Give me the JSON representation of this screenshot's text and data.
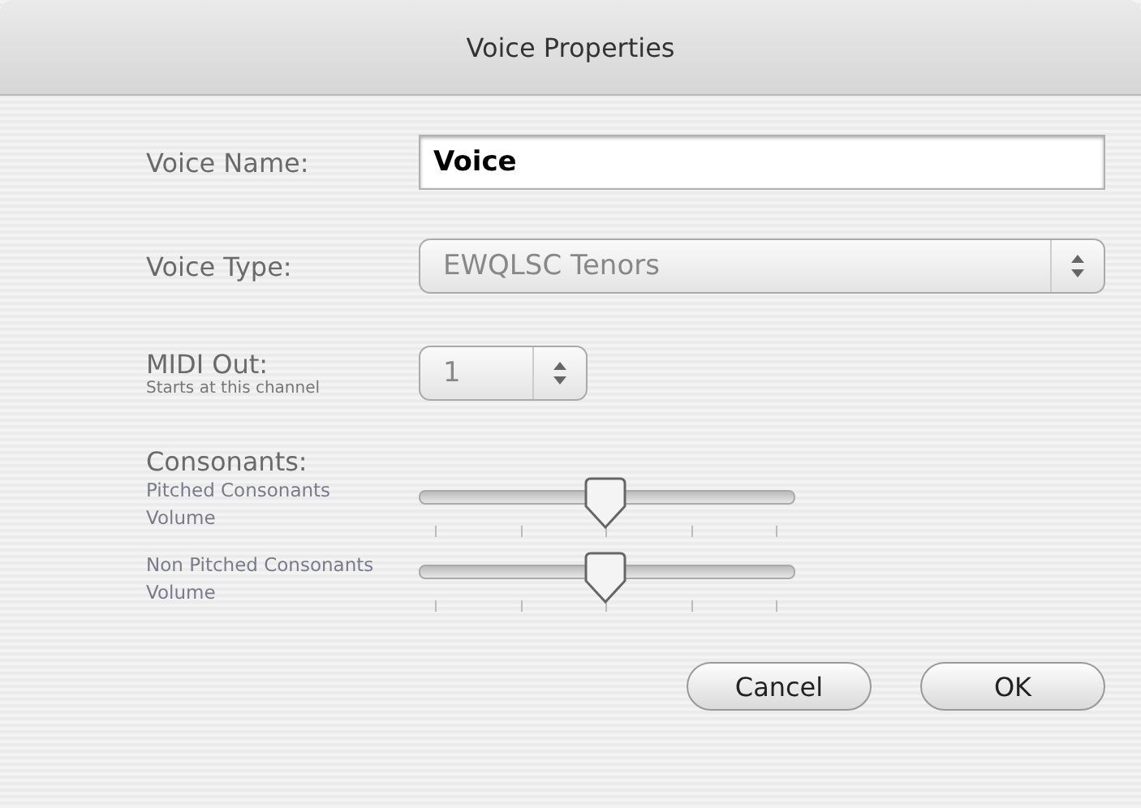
{
  "window": {
    "title": "Voice Properties"
  },
  "voice_name": {
    "label": "Voice Name:",
    "value": "Voice"
  },
  "voice_type": {
    "label": "Voice Type:",
    "value": "EWQLSC Tenors"
  },
  "midi_out": {
    "label": "MIDI Out:",
    "hint": "Starts at this channel",
    "value": "1"
  },
  "consonants": {
    "heading": "Consonants:",
    "sliders": [
      {
        "label": "Pitched Consonants Volume",
        "level": 0.5
      },
      {
        "label": "Non Pitched Consonants Volume",
        "level": 0.5
      }
    ]
  },
  "buttons": [
    {
      "label": "Cancel",
      "default": false
    },
    {
      "label": "OK",
      "default": false
    }
  ]
}
